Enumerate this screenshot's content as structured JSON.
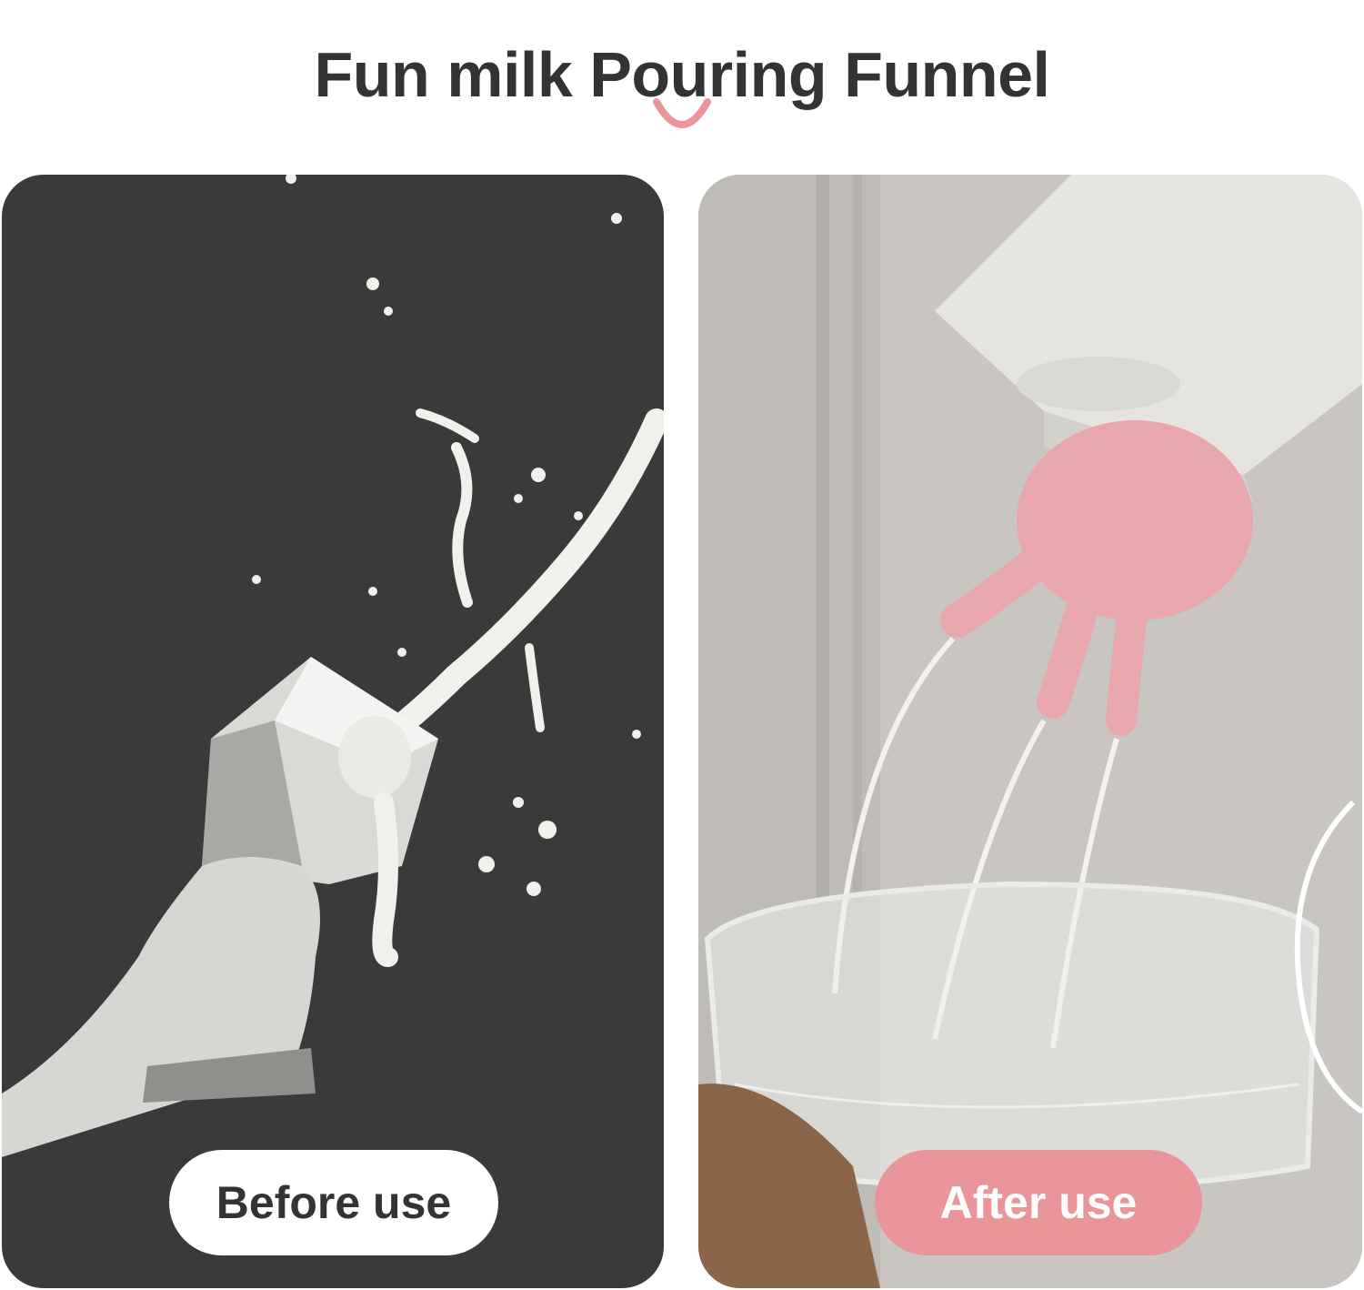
{
  "page": {
    "title": "Fun milk Pouring Funnel"
  },
  "icons": {
    "divider": "smile-arc-icon"
  },
  "panels": {
    "before": {
      "label": "Before use",
      "image": "milk-splash-photo"
    },
    "after": {
      "label": "After use",
      "image": "octopus-funnel-pouring-photo"
    }
  },
  "colors": {
    "accent": "#e9959a",
    "title_text": "#333333",
    "before_bg": "#3a3a3a",
    "after_bg": "#c9c6c1"
  }
}
